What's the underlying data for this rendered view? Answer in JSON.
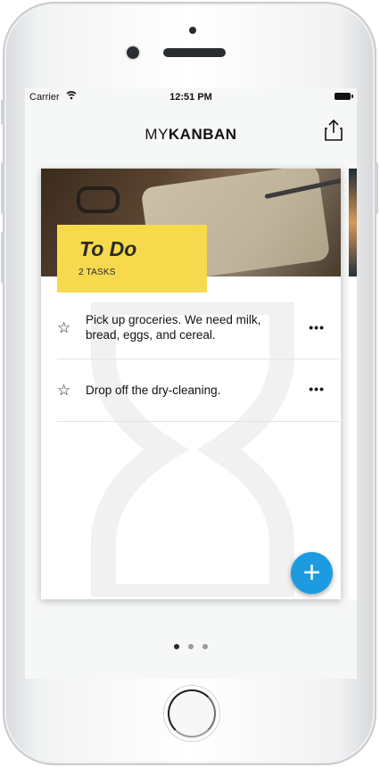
{
  "status_bar": {
    "carrier": "Carrier",
    "time": "12:51 PM"
  },
  "header": {
    "title_light": "MY",
    "title_bold": "KANBAN",
    "share_icon": "share-icon"
  },
  "column": {
    "title": "To Do",
    "count": "2 TASKS",
    "tasks": [
      {
        "text": "Pick up groceries. We need milk, bread, eggs, and cereal."
      },
      {
        "text": "Drop off the dry-cleaning."
      }
    ]
  },
  "icons": {
    "star": "☆",
    "more": "•••",
    "add": "+"
  },
  "pager": {
    "total": 3,
    "active_index": 0
  },
  "colors": {
    "accent": "#1d9be0",
    "header_card": "#f6d94d"
  }
}
